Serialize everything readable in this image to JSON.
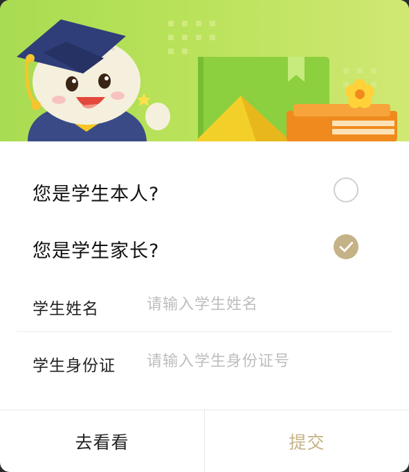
{
  "banner": {
    "illustration": "graduation-mascot-with-books",
    "colors": {
      "background": "#b4df56"
    }
  },
  "options": [
    {
      "label": "您是学生本人?",
      "checked": false
    },
    {
      "label": "您是学生家长?",
      "checked": true
    }
  ],
  "fields": [
    {
      "label": "学生姓名",
      "placeholder": "请输入学生姓名",
      "value": ""
    },
    {
      "label": "学生身份证",
      "placeholder": "请输入学生身份证号",
      "value": ""
    }
  ],
  "footer": {
    "left_label": "去看看",
    "right_label": "提交"
  },
  "colors": {
    "accent": "#c5b286",
    "text": "#111111",
    "placeholder": "#bdbdbd"
  }
}
